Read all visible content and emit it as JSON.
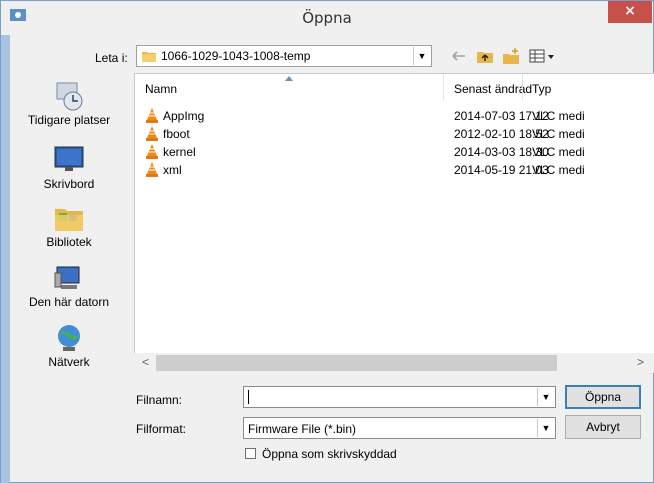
{
  "window": {
    "title": "Öppna",
    "close_glyph": "×"
  },
  "lookin": {
    "label": "Leta i:",
    "value": "1066-1029-1043-1008-temp"
  },
  "toolbar": {
    "icons": [
      "back-arrow-icon",
      "up-folder-icon",
      "new-folder-icon",
      "view-menu-icon"
    ]
  },
  "places": [
    {
      "label": "Tidigare platser",
      "icon": "recent-places-icon"
    },
    {
      "label": "Skrivbord",
      "icon": "desktop-icon"
    },
    {
      "label": "Bibliotek",
      "icon": "libraries-icon"
    },
    {
      "label": "Den här datorn",
      "icon": "computer-icon"
    },
    {
      "label": "Nätverk",
      "icon": "network-icon"
    }
  ],
  "columns": {
    "name": "Namn",
    "date": "Senast ändrad",
    "type": "Typ"
  },
  "files": [
    {
      "name": "AppImg",
      "date": "2014-07-03 17:12",
      "type": "VLC medi"
    },
    {
      "name": "fboot",
      "date": "2012-02-10 18:52",
      "type": "VLC medi"
    },
    {
      "name": "kernel",
      "date": "2014-03-03 18:30",
      "type": "VLC medi"
    },
    {
      "name": "xml",
      "date": "2014-05-19 21:03",
      "type": "VLC medi"
    }
  ],
  "scroll": {
    "left_glyph": "<",
    "right_glyph": ">"
  },
  "filename": {
    "label": "Filnamn:",
    "value": ""
  },
  "filetype": {
    "label": "Filformat:",
    "value": "Firmware File (*.bin)"
  },
  "buttons": {
    "open": "Öppna",
    "cancel": "Avbryt"
  },
  "readonly": {
    "label": "Öppna som skrivskyddad",
    "checked": false
  },
  "colors": {
    "close": "#c7504a",
    "accent": "#3c7fb1"
  }
}
